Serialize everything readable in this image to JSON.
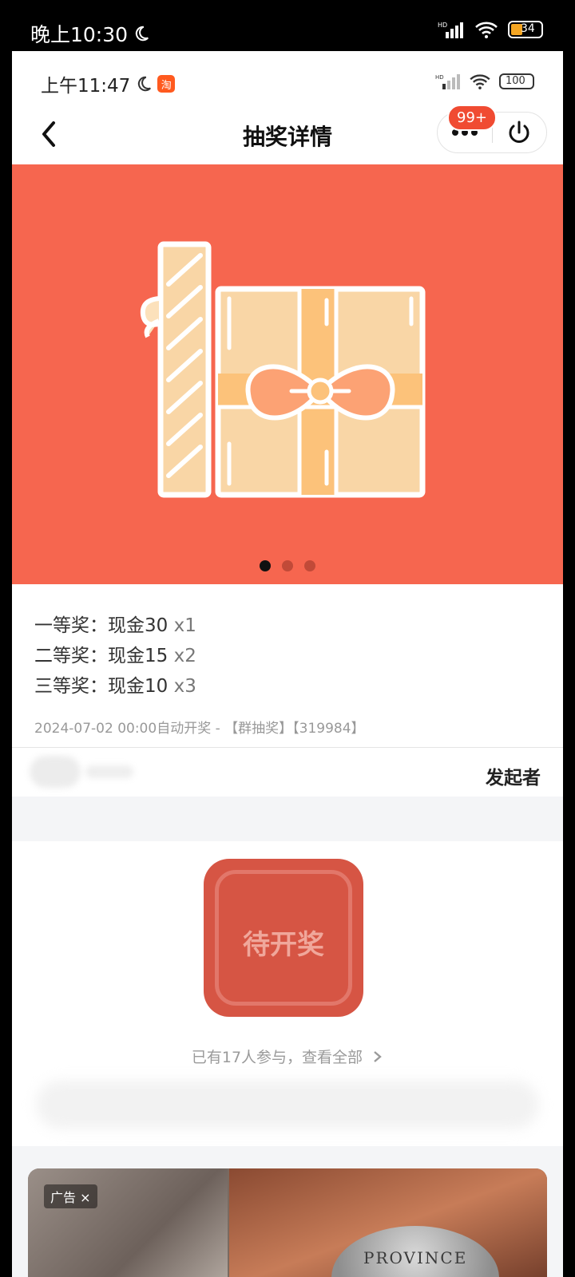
{
  "system_status": {
    "time": "晚上10:30",
    "battery": "34"
  },
  "inner_status": {
    "time": "上午11:47",
    "app_badge": "淘",
    "battery": "100"
  },
  "navbar": {
    "title": "抽奖详情",
    "notification_badge": "99+"
  },
  "banner": {
    "slide_count": 3,
    "active_slide": 1
  },
  "prizes": [
    {
      "label": "一等奖：现金30",
      "qty": " x1"
    },
    {
      "label": "二等奖：现金15",
      "qty": " x2"
    },
    {
      "label": "三等奖：现金10",
      "qty": " x3"
    }
  ],
  "draw_info": "2024-07-02 00:00自动开奖 - 【群抽奖】【319984】",
  "initiator": {
    "label": "发起者"
  },
  "draw_button": {
    "label": "待开奖"
  },
  "participants_text": "已有17人参与，查看全部",
  "ad": {
    "tag": "广告 ×",
    "coin_text": "PROVINCE"
  }
}
